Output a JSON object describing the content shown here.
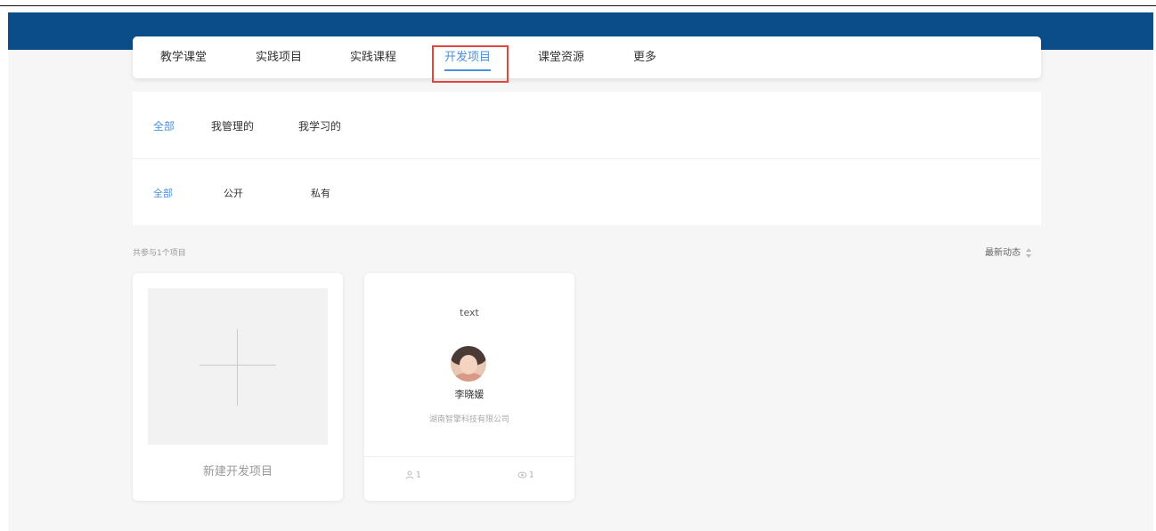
{
  "tabs": [
    {
      "label": "教学课堂",
      "active": false
    },
    {
      "label": "实践项目",
      "active": false
    },
    {
      "label": "实践课程",
      "active": false
    },
    {
      "label": "开发项目",
      "active": true
    },
    {
      "label": "课堂资源",
      "active": false
    },
    {
      "label": "更多",
      "active": false
    }
  ],
  "filters": {
    "ownership": [
      {
        "label": "全部",
        "active": true
      },
      {
        "label": "我管理的",
        "active": false
      },
      {
        "label": "我学习的",
        "active": false
      }
    ],
    "visibility": [
      {
        "label": "全部",
        "active": true
      },
      {
        "label": "公开",
        "active": false
      },
      {
        "label": "私有",
        "active": false
      }
    ]
  },
  "list_header": {
    "count_text": "共参与1个项目",
    "sort_label": "最新动态"
  },
  "new_project": {
    "label": "新建开发项目"
  },
  "projects": [
    {
      "title": "text",
      "owner": "李晓媛",
      "organization": "湖南智擎科技有限公司",
      "members": "1",
      "views": "1"
    }
  ],
  "colors": {
    "banner": "#0a4d89",
    "accent": "#4a90e2",
    "highlight": "#e2453c",
    "page_bg": "#f6f6f6"
  }
}
